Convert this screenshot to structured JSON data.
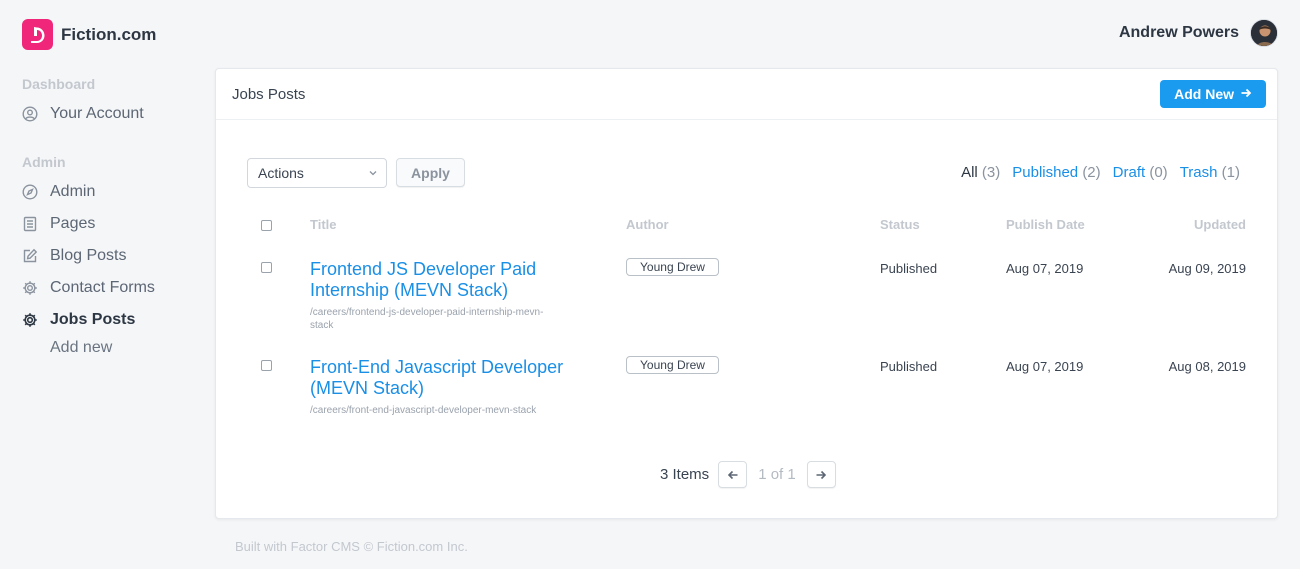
{
  "brand": {
    "name": "Fiction.com",
    "logo_icon": "brand-logo-icon",
    "accent": "#f0267a"
  },
  "user": {
    "name": "Andrew Powers"
  },
  "sidebar": {
    "groups": [
      {
        "title": "Dashboard",
        "items": [
          {
            "label": "Your Account",
            "icon": "user-circle-icon"
          }
        ]
      },
      {
        "title": "Admin",
        "items": [
          {
            "label": "Admin",
            "icon": "compass-icon"
          },
          {
            "label": "Pages",
            "icon": "document-icon"
          },
          {
            "label": "Blog Posts",
            "icon": "edit-icon"
          },
          {
            "label": "Contact Forms",
            "icon": "gear-icon"
          },
          {
            "label": "Jobs Posts",
            "icon": "gear-icon",
            "active": true
          }
        ]
      }
    ],
    "sub_item": "Add new"
  },
  "card": {
    "title": "Jobs Posts",
    "add_new_label": "Add New",
    "add_new_color": "#1a9bf0"
  },
  "toolbar": {
    "actions_value": "Actions",
    "apply_label": "Apply"
  },
  "filters": [
    {
      "label": "All",
      "count": "(3)"
    },
    {
      "label": "Published",
      "count": "(2)"
    },
    {
      "label": "Draft",
      "count": "(0)"
    },
    {
      "label": "Trash",
      "count": "(1)"
    }
  ],
  "table": {
    "columns": [
      "Title",
      "Author",
      "Status",
      "Publish Date",
      "Updated"
    ],
    "rows": [
      {
        "title_line1": "Frontend JS Developer Paid",
        "title_line2": "Internship (MEVN Stack)",
        "path_line1": "/careers/frontend-js-developer-paid-internship-mevn-",
        "path_line2": "stack",
        "author": "Young Drew",
        "status": "Published",
        "publish_date": "Aug 07, 2019",
        "updated": "Aug 09, 2019"
      },
      {
        "title_line1": "Front-End Javascript Developer",
        "title_line2": "(MEVN Stack)",
        "path_line1": "/careers/front-end-javascript-developer-mevn-stack",
        "path_line2": "",
        "author": "Young Drew",
        "status": "Published",
        "publish_date": "Aug 07, 2019",
        "updated": "Aug 08, 2019"
      }
    ]
  },
  "pagination": {
    "count": "3 Items",
    "position": "1 of 1"
  },
  "footer": {
    "text": "Built with Factor CMS © Fiction.com Inc."
  }
}
